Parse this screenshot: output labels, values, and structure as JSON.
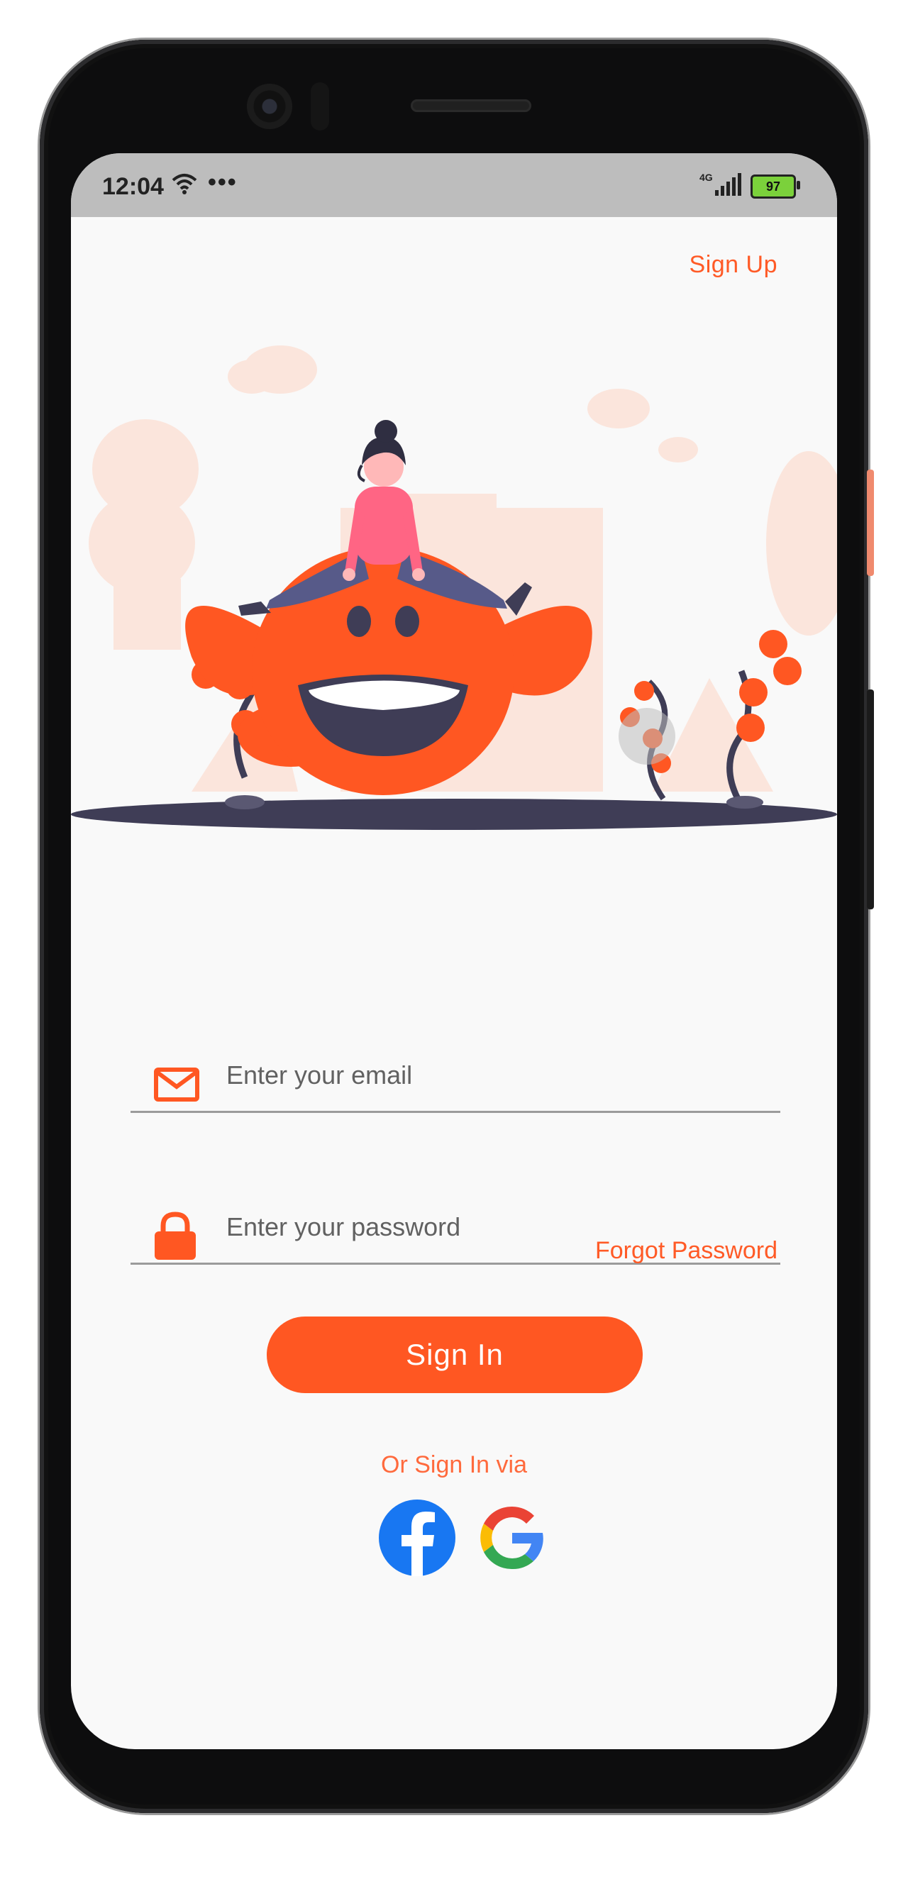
{
  "status_bar": {
    "time": "12:04",
    "overflow": "•••",
    "network": "4G",
    "battery": "97",
    "icons": [
      "wifi-icon",
      "signal-icon",
      "battery-icon"
    ]
  },
  "header": {
    "signup_label": "Sign Up"
  },
  "form": {
    "email": {
      "value": "",
      "placeholder": "Enter your email",
      "icon": "mail-icon"
    },
    "password": {
      "value": "",
      "placeholder": "Enter your password",
      "icon": "lock-icon"
    },
    "forgot_label": "Forgot Password",
    "signin_label": "Sign In",
    "social_label": "Or Sign In via",
    "social_icons": [
      "facebook-icon",
      "google-icon"
    ]
  },
  "colors": {
    "accent": "#ff5722",
    "status_bar": "#bdbdbd",
    "background": "#f9f9f9",
    "illustration_dark": "#3f3d56"
  }
}
